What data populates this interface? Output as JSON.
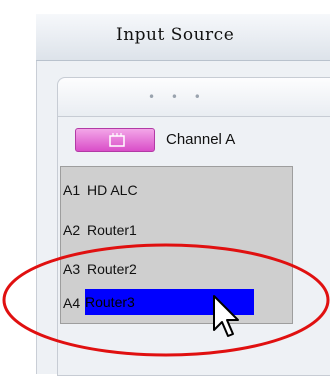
{
  "window": {
    "title": "Input Source"
  },
  "panel": {
    "grip": "• • •"
  },
  "channel": {
    "label": "Channel A",
    "icon": "channel-icon"
  },
  "list": {
    "items": [
      {
        "code": "A1",
        "name": "HD ALC",
        "selected": false
      },
      {
        "code": "A2",
        "name": "Router1",
        "selected": false
      },
      {
        "code": "A3",
        "name": "Router2",
        "selected": false
      },
      {
        "code": "A4",
        "name": "Router3",
        "selected": true
      }
    ]
  },
  "colors": {
    "selection": "#0000ff",
    "annotation": "#e01010",
    "channel_icon": "#d94ec8"
  }
}
